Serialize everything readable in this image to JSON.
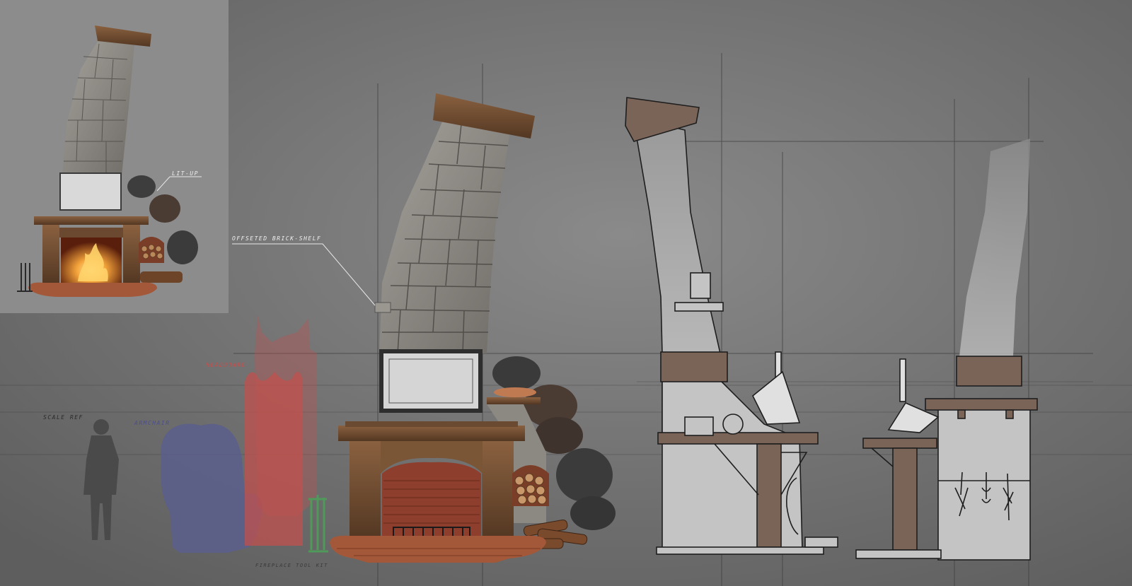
{
  "annotations": {
    "lit_up": "LIT-UP",
    "offseted_brick_shelf": "OFFSETED BRICK-SHELF",
    "headboard": "HEADBOARD",
    "scale_ref": "SCALE REF",
    "armchair": "ARMCHAIR",
    "fireplace_tool_kit": "FIREPLACE TOOL KIT"
  },
  "colors": {
    "background": "#787878",
    "inset_panel": "#8c8c8c",
    "stone": "#8e8a85",
    "wood": "#6b4a32",
    "brick": "#9a4d33",
    "fire": "#f4a33a",
    "headboard": "#c0504d",
    "armchair": "#5a5e8c",
    "tool_kit": "#4f9a5a",
    "sketch_fill": "#b8b8b8",
    "sketch_line": "#1e1e1e"
  }
}
